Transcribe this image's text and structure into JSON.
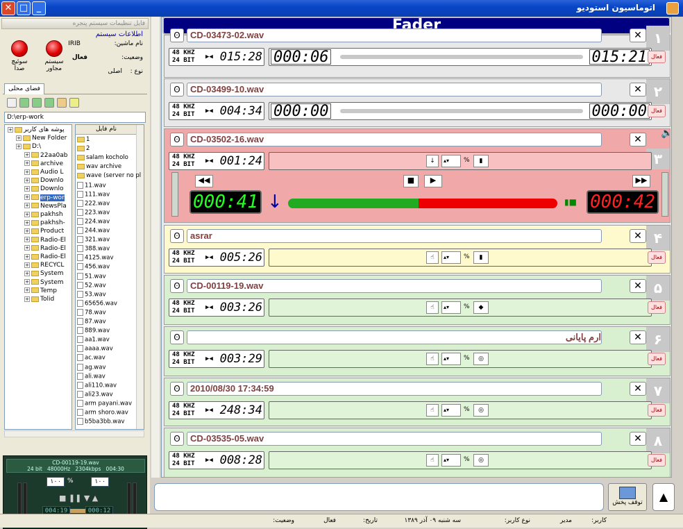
{
  "window": {
    "title": "اتوماسیون استودیو"
  },
  "left": {
    "menu": "فایل   تنظیمات سیستم   پنجره",
    "sysinfo_title": "اطلاعات سیستم",
    "machine_label": "نام ماشین:",
    "machine_value": "IRIB",
    "state_label": "وضعیت:",
    "state_value": "فعال",
    "type_label": "نوع :",
    "type_value": "اصلی",
    "btn_switch": "سوئیچ صدا",
    "btn_system": "سیستم مجاور",
    "tab": "فضای محلی",
    "path": "D:\\erp-work",
    "tree": [
      "پوشه های کاربر",
      "New Folder",
      "D:\\",
      "22aa0ab",
      "archive",
      "Audio L",
      "Downlo",
      "Downlo",
      "erp-wor",
      "NewsPla",
      "pakhsh",
      "pakhsh-",
      "Product",
      "Radio-El",
      "Radio-El",
      "Radio-El",
      "RECYCL",
      "System",
      "System",
      "Temp",
      "Tolid"
    ],
    "files_header": "نام فایل",
    "files": [
      "1",
      "2",
      "salam kocholo",
      "wav archive",
      "wave (server no pl",
      "11.wav",
      "111.wav",
      "222.wav",
      "223.wav",
      "224.wav",
      "244.wav",
      "321.wav",
      "388.wav",
      "4125.wav",
      "456.wav",
      "51.wav",
      "52.wav",
      "53.wav",
      "65656.wav",
      "78.wav",
      "87.wav",
      "889.wav",
      "aa1.wav",
      "aaaa.wav",
      "ac.wav",
      "ag.wav",
      "ali.wav",
      "ali110.wav",
      "ali23.wav",
      "arm payani.wav",
      "arm shoro.wav",
      "b5ba3bb.wav"
    ]
  },
  "player": {
    "file": "CD-00119-19.wav",
    "bits": "24 bit",
    "rate": "48000Hz",
    "kbps": "2304kbps",
    "dur": "004:30",
    "vol1": "۱۰۰",
    "pct": "%",
    "vol2": "۱۰۰",
    "t1": "004:19",
    "t2": "000:12"
  },
  "header": "Fader",
  "slots": [
    {
      "num": "۱",
      "name": "CD-03473-02.wav",
      "fmt1": "48 KHZ",
      "fmt2": "24 BIT",
      "dur": "015:28",
      "elapsed": "000:06",
      "remain": "015:21",
      "bg": "#e8e8e8",
      "act": "فعال"
    },
    {
      "num": "۲",
      "name": "CD-03499-10.wav",
      "fmt1": "48 KHZ",
      "fmt2": "24 BIT",
      "dur": "004:34",
      "elapsed": "000:00",
      "remain": "000:00",
      "bg": "#e8e8e8",
      "act": "فعال"
    },
    {
      "num": "۳",
      "name": "CD-03502-16.wav",
      "fmt1": "48 KHZ",
      "fmt2": "24 BIT",
      "dur": "001:24",
      "elapsed": "000:41",
      "remain": "000:42",
      "bg": "#f0a8a8",
      "act": ""
    },
    {
      "num": "۴",
      "name": "asrar",
      "fmt1": "48 KHZ",
      "fmt2": "24 BIT",
      "dur": "005:26",
      "bg": "#fffacd",
      "act": "فعال"
    },
    {
      "num": "۵",
      "name": "CD-00119-19.wav",
      "fmt1": "48 KHZ",
      "fmt2": "24 BIT",
      "dur": "003:26",
      "bg": "#d8f0d0",
      "act": "فعال"
    },
    {
      "num": "۶",
      "name": "ارم پایانی",
      "fmt1": "48 KHZ",
      "fmt2": "24 BIT",
      "dur": "003:29",
      "bg": "#d8f0d0",
      "act": "فعال"
    },
    {
      "num": "۷",
      "name": "2010/08/30 17:34:59",
      "fmt1": "48 KHZ",
      "fmt2": "24 BIT",
      "dur": "248:34",
      "bg": "#d8f0d0",
      "act": "فعال"
    },
    {
      "num": "۸",
      "name": "CD-03535-05.wav",
      "fmt1": "48 KHZ",
      "fmt2": "24 BIT",
      "dur": "008:28",
      "bg": "#d8f0d0",
      "act": "فعال"
    }
  ],
  "stop_label": "توقف پخش",
  "status": {
    "user_label": "کاربر:",
    "user_value": "مدیر",
    "utype_label": "نوع کاربر:",
    "date_value": "سه شنبه ۰۹ آذر ۱۳۸۹",
    "date_label": "تاریخ:",
    "state_value": "فعال",
    "state_label": "وضعیت:"
  }
}
